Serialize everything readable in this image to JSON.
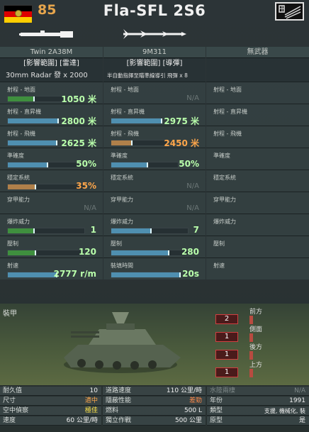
{
  "header": {
    "cost": "85",
    "title": "Fla-SFL 2S6",
    "colors": {
      "accent": "#e7a54c"
    }
  },
  "weapons": [
    {
      "name": "Twin 2A38M",
      "tags": "[影響範圍] [雷達]",
      "subline": "30mm Radar 發 x 2000",
      "stats": {
        "ground_range": {
          "label": "射程 - 地面",
          "value": "1050 米",
          "fill": 0.45,
          "color": "green"
        },
        "heli_range": {
          "label": "射程 - 直昇機",
          "value": "2800 米",
          "fill": 0.55,
          "color": "blue"
        },
        "air_range": {
          "label": "射程 - 飛機",
          "value": "2625 米",
          "fill": 0.52,
          "color": "blue"
        },
        "accuracy": {
          "label": "準確度",
          "value": "50%",
          "fill": 0.5,
          "color": "blue"
        },
        "stab": {
          "label": "穩定系統",
          "value": "35%",
          "fill": 0.35,
          "color": "orange"
        },
        "pen": {
          "label": "穿甲能力",
          "value": "N/A"
        },
        "he": {
          "label": "爆炸威力",
          "value": "1",
          "fill": 0.32,
          "color": "green"
        },
        "supp": {
          "label": "壓制",
          "value": "120",
          "fill": 0.35,
          "color": "green"
        },
        "rof": {
          "label": "射速",
          "value": "2777 r/m",
          "fill": 0.9,
          "color": "blue"
        }
      }
    },
    {
      "name": "9M311",
      "tags": "[影響範圍] [導彈]",
      "subline": "半自動指揮至瞄準線導引 飛彈 x 8",
      "stats": {
        "ground_range": {
          "label": "射程 - 地面",
          "value": "N/A"
        },
        "heli_range": {
          "label": "射程 - 直昇機",
          "value": "2975 米",
          "fill": 0.6,
          "color": "blue"
        },
        "air_range": {
          "label": "射程 - 飛機",
          "value": "2450 米",
          "fill": 0.3,
          "color": "orange"
        },
        "accuracy": {
          "label": "準確度",
          "value": "50%",
          "fill": 0.46,
          "color": "blue"
        },
        "stab": {
          "label": "穩定系統",
          "value": "N/A"
        },
        "pen": {
          "label": "穿甲能力",
          "value": "N/A"
        },
        "he": {
          "label": "爆炸威力",
          "value": "7",
          "fill": 0.52,
          "color": "blue"
        },
        "supp": {
          "label": "壓制",
          "value": "280",
          "fill": 0.75,
          "color": "blue"
        },
        "reload": {
          "label": "裝填時間",
          "value": "20s",
          "fill": 0.88,
          "color": "blue"
        }
      }
    },
    {
      "name": "無武器",
      "stats": {
        "ground_range": {
          "label": "射程 - 地面"
        },
        "heli_range": {
          "label": "射程 - 直昇機"
        },
        "air_range": {
          "label": "射程 - 飛機"
        },
        "accuracy": {
          "label": "準確度"
        },
        "stab": {
          "label": "穩定系統"
        },
        "pen": {
          "label": "穿甲能力"
        },
        "he": {
          "label": "爆炸威力"
        },
        "supp": {
          "label": "壓制"
        },
        "rof": {
          "label": "射速"
        }
      }
    }
  ],
  "armor": {
    "title": "裝甲",
    "front": {
      "label": "前方",
      "value": "2"
    },
    "side": {
      "label": "側面",
      "value": "1"
    },
    "rear": {
      "label": "後方",
      "value": "1"
    },
    "top": {
      "label": "上方",
      "value": "1"
    }
  },
  "bottom": {
    "durability": {
      "label": "耐久值",
      "value": "10"
    },
    "size": {
      "label": "尺寸",
      "value": "適中"
    },
    "air_recon": {
      "label": "空中偵察",
      "value": "極佳"
    },
    "speed": {
      "label": "速度",
      "value": "60 公里/時"
    },
    "road_speed": {
      "label": "道路速度",
      "value": "110 公里/時"
    },
    "stealth": {
      "label": "隱蔽性能",
      "value": "差勁"
    },
    "fuel": {
      "label": "燃料",
      "value": "500 L"
    },
    "autonomy": {
      "label": "獨立作戰",
      "value": "500 公里"
    },
    "amphibious": {
      "label": "水陸兩棲",
      "value": "N/A"
    },
    "year": {
      "label": "年份",
      "value": "1991"
    },
    "type": {
      "label": "類型",
      "value": "支援, 機械化, 裝"
    },
    "prototype": {
      "label": "原型",
      "value": "是"
    }
  }
}
